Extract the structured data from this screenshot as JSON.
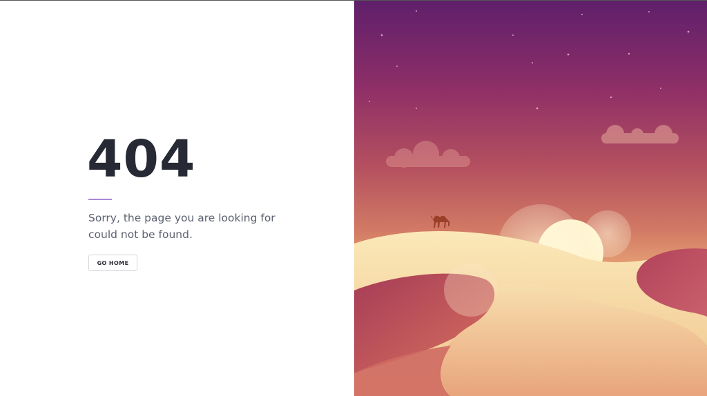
{
  "error": {
    "code": "404",
    "message": "Sorry, the page you are looking for could not be found.",
    "accent_color": "#a98ad9"
  },
  "actions": {
    "home_button_label": "GO HOME"
  },
  "illustration": {
    "subject": "desert-dunes-sunset-with-camel",
    "colors": {
      "sky_top": "#5f1f6b",
      "sky_mid": "#b24a62",
      "sky_low": "#e8a07a",
      "sun": "#fff6d6",
      "dune_light": "#f4dcaa",
      "dune_dark": "#b5485f"
    }
  }
}
